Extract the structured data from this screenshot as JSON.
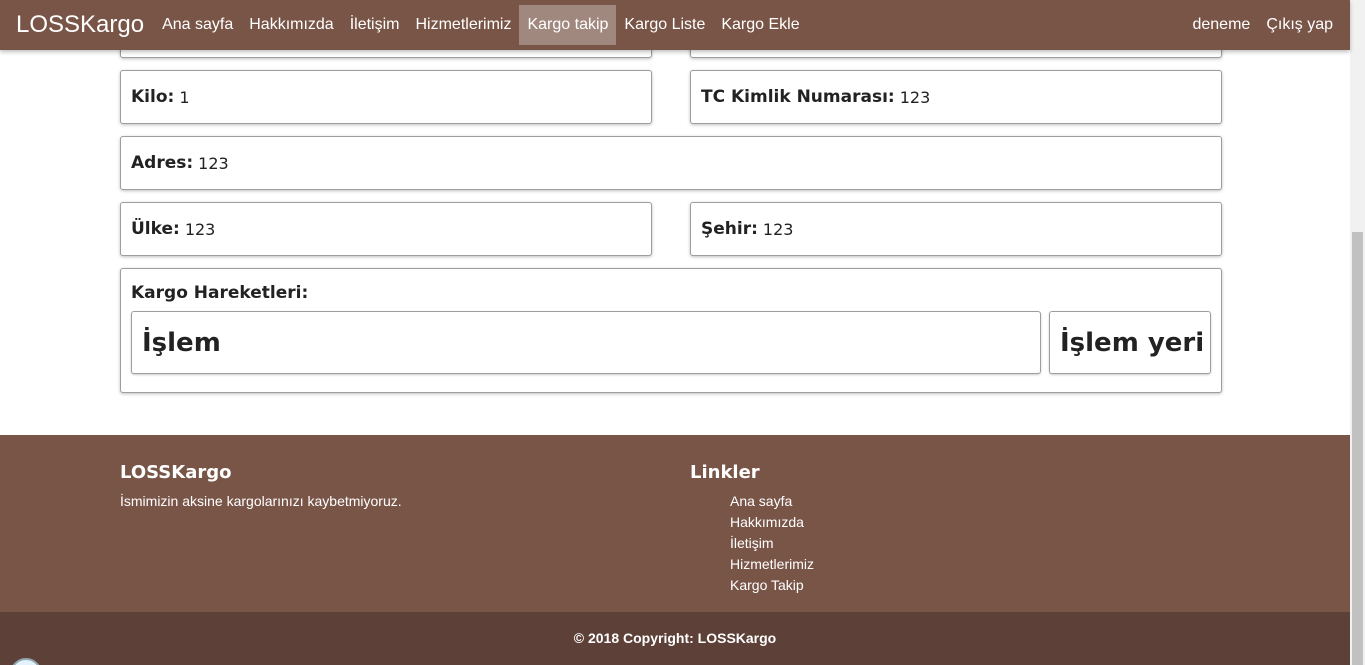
{
  "nav": {
    "brand": "LOSSKargo",
    "items": [
      {
        "label": "Ana sayfa"
      },
      {
        "label": "Hakkımızda"
      },
      {
        "label": "İletişim"
      },
      {
        "label": "Hizmetlerimiz"
      },
      {
        "label": "Kargo takip",
        "active": true
      },
      {
        "label": "Kargo Liste"
      },
      {
        "label": "Kargo Ekle"
      }
    ],
    "user": "deneme",
    "logout": "Çıkış yap"
  },
  "details": {
    "kilo": {
      "label": "Kilo:",
      "value": "1"
    },
    "tc": {
      "label": "TC Kimlik Numarası:",
      "value": "123"
    },
    "adres": {
      "label": "Adres:",
      "value": "123"
    },
    "ulke": {
      "label": "Ülke:",
      "value": "123"
    },
    "sehir": {
      "label": "Şehir:",
      "value": "123"
    }
  },
  "movements": {
    "title": "Kargo Hareketleri:",
    "col_islem": "İşlem",
    "col_yer": "İşlem yeri"
  },
  "footer": {
    "brand": "LOSSKargo",
    "description": "İsmimizin aksine kargolarınızı kaybetmiyoruz.",
    "links_title": "Linkler",
    "links": [
      "Ana sayfa",
      "Hakkımızda",
      "İletişim",
      "Hizmetlerimiz",
      "Kargo Takip"
    ],
    "copyright": "© 2018 Copyright: LOSSKargo"
  },
  "colors": {
    "primary": "#795548",
    "dark": "#5d4037",
    "active": "#a1887f"
  }
}
